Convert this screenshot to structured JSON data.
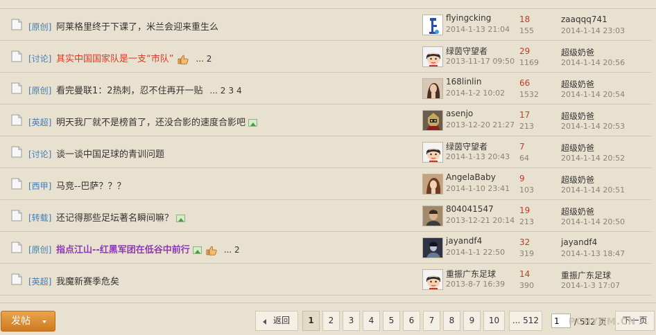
{
  "threads": [
    {
      "category": "[原创]",
      "title": "阿莱格里终于下课了，米兰会迎来重生么",
      "style": "normal",
      "pages": [],
      "has_image": false,
      "has_thumb": false,
      "author": "flyingcking",
      "author_date": "2014-1-13 21:04",
      "replies": "18",
      "views": "155",
      "last_user": "zaaqqq741",
      "last_date": "2014-1-14 23:03",
      "avatar": "figure"
    },
    {
      "category": "[讨论]",
      "title": "其实中国国家队是一支“市队”",
      "style": "red",
      "pages": [
        "... 2"
      ],
      "has_image": false,
      "has_thumb": true,
      "author": "绿茵守望者",
      "author_date": "2013-11-17 09:50",
      "replies": "29",
      "views": "1169",
      "last_user": "超级奶爸",
      "last_date": "2014-1-14 20:56",
      "avatar": "cartoon"
    },
    {
      "category": "[原创]",
      "title": "看完曼联1：2热刺，忍不住再开一贴",
      "style": "normal",
      "pages": [
        "... 2",
        "3",
        "4"
      ],
      "has_image": false,
      "has_thumb": false,
      "author": "168linlin",
      "author_date": "2014-1-2 10:02",
      "replies": "66",
      "views": "1532",
      "last_user": "超级奶爸",
      "last_date": "2014-1-14 20:54",
      "avatar": "photo-woman"
    },
    {
      "category": "[英超]",
      "title": "明天我厂就不是榜首了，还没合影的速度合影吧",
      "style": "normal",
      "pages": [],
      "has_image": true,
      "has_thumb": false,
      "author": "asenjo",
      "author_date": "2013-12-20 21:27",
      "replies": "17",
      "views": "213",
      "last_user": "超级奶爸",
      "last_date": "2014-1-14 20:53",
      "avatar": "photo-fighter"
    },
    {
      "category": "[讨论]",
      "title": "谈一谈中国足球的青训问题",
      "style": "normal",
      "pages": [],
      "has_image": false,
      "has_thumb": false,
      "author": "绿茵守望者",
      "author_date": "2014-1-13 20:43",
      "replies": "7",
      "views": "64",
      "last_user": "超级奶爸",
      "last_date": "2014-1-14 20:52",
      "avatar": "cartoon"
    },
    {
      "category": "[西甲]",
      "title": "马竞--巴萨？？？",
      "style": "normal",
      "pages": [],
      "has_image": false,
      "has_thumb": false,
      "author": "AngelaBaby",
      "author_date": "2014-1-10 23:41",
      "replies": "9",
      "views": "103",
      "last_user": "超级奶爸",
      "last_date": "2014-1-14 20:51",
      "avatar": "photo-girl"
    },
    {
      "category": "[转载]",
      "title": "还记得那些足坛著名瞬间嘛？",
      "style": "normal",
      "pages": [],
      "has_image": true,
      "has_thumb": false,
      "author": "804041547",
      "author_date": "2013-12-21 20:14",
      "replies": "19",
      "views": "213",
      "last_user": "超级奶爸",
      "last_date": "2014-1-14 20:50",
      "avatar": "photo-man"
    },
    {
      "category": "[原创]",
      "title": "指点江山--红黑军团在低谷中前行",
      "style": "purple",
      "pages": [
        "... 2"
      ],
      "has_image": true,
      "has_thumb": true,
      "author": "jayandf4",
      "author_date": "2014-1-1 22:50",
      "replies": "32",
      "views": "319",
      "last_user": "jayandf4",
      "last_date": "2014-1-13 18:47",
      "avatar": "photo-dark"
    },
    {
      "category": "[英超]",
      "title": "我魔新赛季危矣",
      "style": "normal",
      "pages": [],
      "has_image": false,
      "has_thumb": false,
      "author": "重振广东足球",
      "author_date": "2013-8-7 16:39",
      "replies": "14",
      "views": "390",
      "last_user": "重振广东足球",
      "last_date": "2014-1-3 17:07",
      "avatar": "cartoon"
    }
  ],
  "footer": {
    "post_button": "发帖",
    "back_label": "返回",
    "pages": [
      "1",
      "2",
      "3",
      "4",
      "5",
      "6",
      "7",
      "8",
      "9",
      "10",
      "... 512"
    ],
    "current_page": "1",
    "page_input_value": "1",
    "total_label": "/ 512 页",
    "next_label": "下一页",
    "watermark": "PCHYGM.CN"
  },
  "colors": {
    "background": "#e9e1cf",
    "category": "#3f7dbb",
    "replies": "#c0392b",
    "title_red": "#d83a2a",
    "title_purple": "#8c3ab0",
    "post_button": "#d9852a"
  },
  "icons": {
    "row_icon": "document-icon",
    "image_attachment": "image-icon",
    "rating": "thumbs-up-icon",
    "back": "arrow-left-icon",
    "dropdown": "caret-down-icon"
  }
}
